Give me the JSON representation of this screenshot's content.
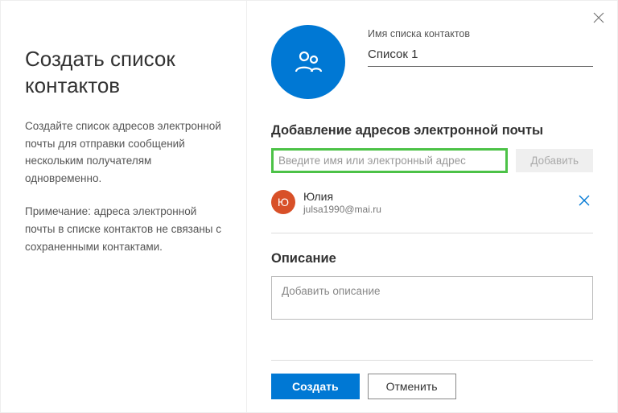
{
  "left": {
    "title": "Создать список контактов",
    "para1": "Создайте список адресов электронной почты для отправки сообщений нескольким получателям одновременно.",
    "para2": "Примечание: адреса электронной почты в списке контактов не связаны с сохраненными контактами."
  },
  "header": {
    "name_label": "Имя списка контактов",
    "name_value": "Список 1"
  },
  "email_section": {
    "title": "Добавление адресов электронной почты",
    "input_placeholder": "Введите имя или электронный адрес",
    "add_button": "Добавить"
  },
  "contact": {
    "initial": "Ю",
    "name": "Юлия",
    "email": "julsa1990@mai.ru"
  },
  "description": {
    "title": "Описание",
    "placeholder": "Добавить описание"
  },
  "footer": {
    "create": "Создать",
    "cancel": "Отменить"
  }
}
